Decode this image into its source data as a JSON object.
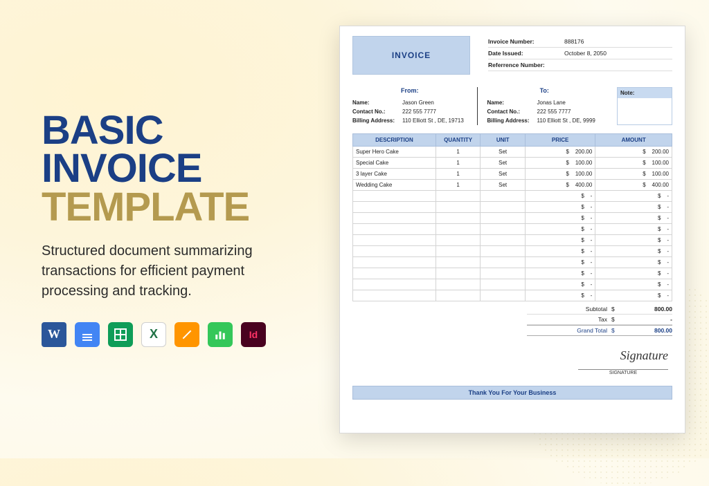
{
  "hero": {
    "line1": "BASIC",
    "line2": "INVOICE",
    "line3": "TEMPLATE",
    "subtitle": "Structured document summarizing transactions for efficient payment processing and tracking."
  },
  "apps": {
    "word": "Word",
    "gdoc": "Google Docs",
    "gsheet": "Google Sheets",
    "excel": "Excel",
    "pages": "Pages",
    "numbers": "Numbers",
    "indesign": "InDesign"
  },
  "invoice": {
    "badge": "INVOICE",
    "meta": {
      "invoice_number_label": "Invoice Number:",
      "invoice_number": "888176",
      "date_issued_label": "Date Issued:",
      "date_issued": "October 8, 2050",
      "reference_label": "Referrence Number:",
      "reference": ""
    },
    "from_heading": "From:",
    "to_heading": "To:",
    "note_heading": "Note:",
    "labels": {
      "name": "Name:",
      "contact": "Contact No.:",
      "billing": "Billing Address:"
    },
    "from": {
      "name": "Jason Green",
      "contact": "222 555 7777",
      "billing": "110 Elliott St , DE, 19713"
    },
    "to": {
      "name": "Jonas Lane",
      "contact": "222 555 7777",
      "billing": "110 Elliott St , DE, 9999"
    },
    "columns": {
      "description": "DESCRIPTION",
      "quantity": "QUANTITY",
      "unit": "Unit",
      "price": "PRICE",
      "amount": "AMOUNT"
    },
    "currency": "$",
    "dash": "-",
    "items": [
      {
        "desc": "Super Hero Cake",
        "qty": "1",
        "unit": "Set",
        "price": "200.00",
        "amount": "200.00"
      },
      {
        "desc": "Special Cake",
        "qty": "1",
        "unit": "Set",
        "price": "100.00",
        "amount": "100.00"
      },
      {
        "desc": "3 layer Cake",
        "qty": "1",
        "unit": "Set",
        "price": "100.00",
        "amount": "100.00"
      },
      {
        "desc": "Wedding Cake",
        "qty": "1",
        "unit": "Set",
        "price": "400.00",
        "amount": "400.00"
      }
    ],
    "empty_rows": 10,
    "totals": {
      "subtotal_label": "Subtotal",
      "subtotal": "800.00",
      "tax_label": "Tax",
      "tax": "-",
      "grand_label": "Grand Total",
      "grand": "800.00"
    },
    "signature_script": "Signature",
    "signature_label": "SIGNATURE",
    "thanks": "Thank You For Your Business"
  }
}
